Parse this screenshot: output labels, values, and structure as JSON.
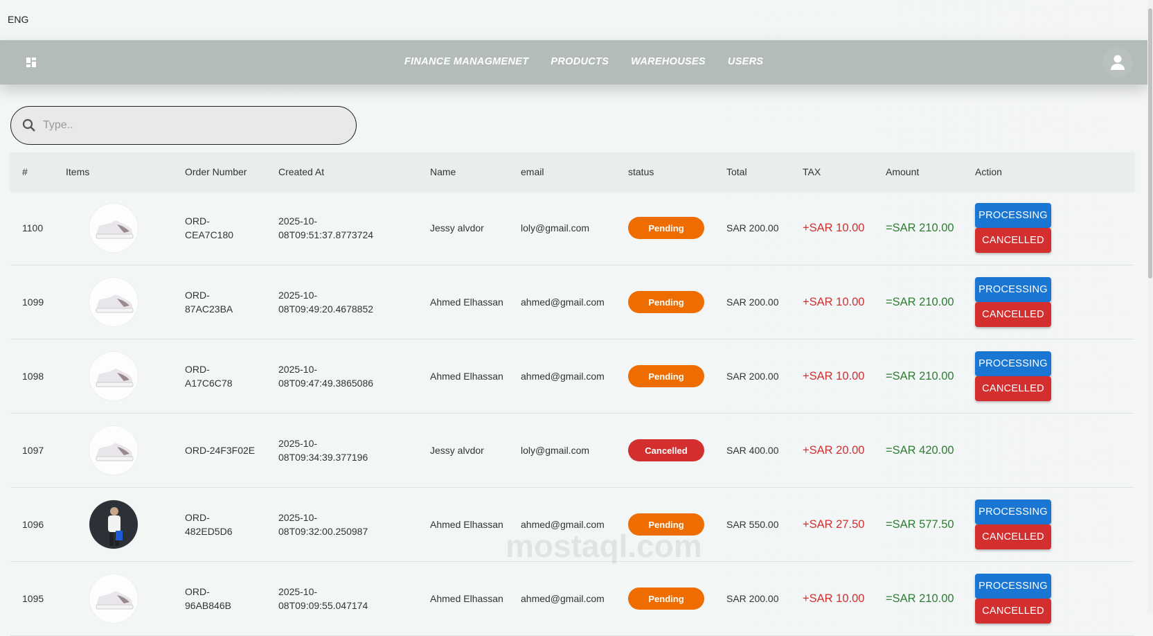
{
  "lang": "ENG",
  "nav": {
    "links": [
      "FINANCE MANAGMENET",
      "PRODUCTS",
      "WAREHOUSES",
      "USERS"
    ]
  },
  "search": {
    "placeholder": "Type.."
  },
  "table": {
    "headers": [
      "#",
      "Items",
      "Order Number",
      "Created At",
      "Name",
      "email",
      "status",
      "Total",
      "TAX",
      "Amount",
      "Action"
    ],
    "rows": [
      {
        "id": "1100",
        "order": "ORD-CEA7C180",
        "order_l1": "ORD-",
        "order_l2": "CEA7C180",
        "created_l1": "2025-10-",
        "created_l2": "08T09:51:37.8773724",
        "name": "Jessy alvdor",
        "email": "loly@gmail.com",
        "status": "Pending",
        "total": "SAR 200.00",
        "tax": "+SAR 10.00",
        "amount": "=SAR 210.00",
        "image": "shoe"
      },
      {
        "id": "1099",
        "order_l1": "ORD-",
        "order_l2": "87AC23BA",
        "created_l1": "2025-10-",
        "created_l2": "08T09:49:20.4678852",
        "name": "Ahmed Elhassan",
        "email": "ahmed@gmail.com",
        "status": "Pending",
        "total": "SAR 200.00",
        "tax": "+SAR 10.00",
        "amount": "=SAR 210.00",
        "image": "shoe"
      },
      {
        "id": "1098",
        "order_l1": "ORD-",
        "order_l2": "A17C6C78",
        "created_l1": "2025-10-",
        "created_l2": "08T09:47:49.3865086",
        "name": "Ahmed Elhassan",
        "email": "ahmed@gmail.com",
        "status": "Pending",
        "total": "SAR 200.00",
        "tax": "+SAR 10.00",
        "amount": "=SAR 210.00",
        "image": "shoe"
      },
      {
        "id": "1097",
        "order_l1": "ORD-24F3F02E",
        "order_l2": "",
        "created_l1": "2025-10-",
        "created_l2": "08T09:34:39.377196",
        "name": "Jessy alvdor",
        "email": "loly@gmail.com",
        "status": "Cancelled",
        "total": "SAR 400.00",
        "tax": "+SAR 20.00",
        "amount": "=SAR 420.00",
        "image": "shoe"
      },
      {
        "id": "1096",
        "order_l1": "ORD-",
        "order_l2": "482ED5D6",
        "created_l1": "2025-10-",
        "created_l2": "08T09:32:00.250987",
        "name": "Ahmed Elhassan",
        "email": "ahmed@gmail.com",
        "status": "Pending",
        "total": "SAR 550.00",
        "tax": "+SAR 27.50",
        "amount": "=SAR 577.50",
        "image": "person"
      },
      {
        "id": "1095",
        "order_l1": "ORD-",
        "order_l2": "96AB846B",
        "created_l1": "2025-10-",
        "created_l2": "08T09:09:55.047174",
        "name": "Ahmed Elhassan",
        "email": "ahmed@gmail.com",
        "status": "Pending",
        "total": "SAR 200.00",
        "tax": "+SAR 10.00",
        "amount": "=SAR 210.00",
        "image": "shoe"
      }
    ],
    "actions": {
      "processing": "PROCESSING",
      "cancelled": "CANCELLED"
    }
  },
  "colors": {
    "pending": "#ef6c00",
    "cancelled": "#d32f2f",
    "processing": "#1976d2"
  },
  "watermark": "مستقل mostaql.com"
}
